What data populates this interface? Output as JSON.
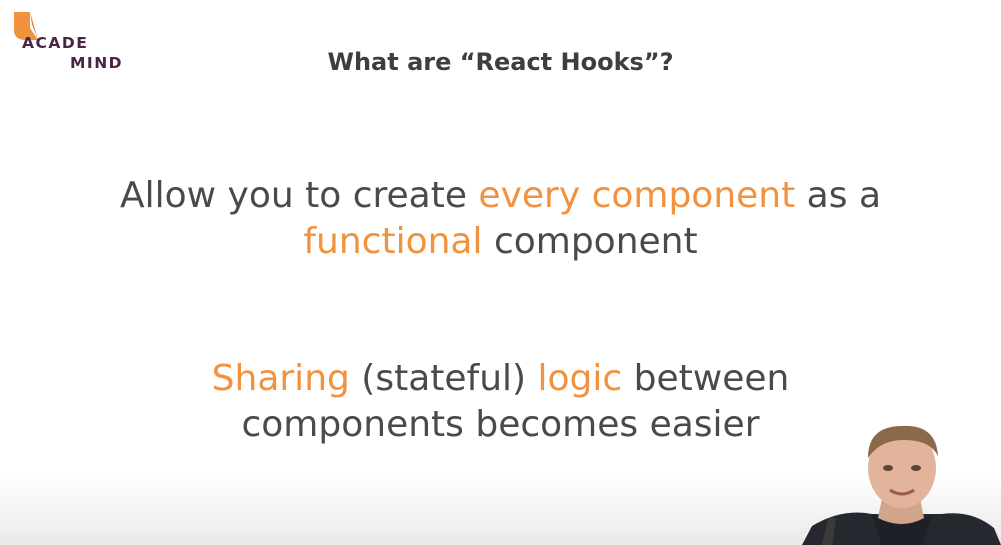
{
  "logo": {
    "line1": "ACADE",
    "line2": "MIND",
    "colors": {
      "brand_orange": "#f0923e",
      "brand_purple": "#4a2345"
    }
  },
  "slide": {
    "title": "What are “React Hooks”?",
    "point1": {
      "t1": "Allow you to create ",
      "h1": "every component",
      "t2": " as a",
      "h2": "functional",
      "t3": " component"
    },
    "point2": {
      "h1": "Sharing",
      "t1": " (stateful) ",
      "h2": "logic",
      "t2": " between",
      "t3": "components becomes easier"
    }
  },
  "colors": {
    "text": "#4a4a4a",
    "highlight": "#f0923e",
    "title": "#3e3e3e"
  },
  "presenter": {
    "icon": "presenter-webcam"
  }
}
